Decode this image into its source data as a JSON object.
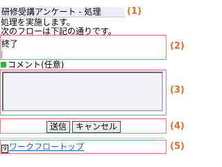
{
  "header": {
    "title": "研修受講アンケート - 処理",
    "intro_line1": "処理を実施します。",
    "intro_line2": "次のフローは下記の通りです。"
  },
  "next_flow": {
    "value": "終了"
  },
  "comment": {
    "label": "コメント(任意)",
    "value": ""
  },
  "actions": {
    "send_label": "送信",
    "cancel_label": "キャンセル"
  },
  "footer": {
    "access_key": "9",
    "link_label": "ワークフロートップ"
  },
  "annotations": {
    "m1": "(1)",
    "m2": "(2)",
    "m3": "(3)",
    "m4": "(4)",
    "m5": "(5)"
  },
  "colors": {
    "frame": "#e58082",
    "marker": "#e07030",
    "link": "#1a66cc",
    "label_square": "#2fb43a"
  }
}
